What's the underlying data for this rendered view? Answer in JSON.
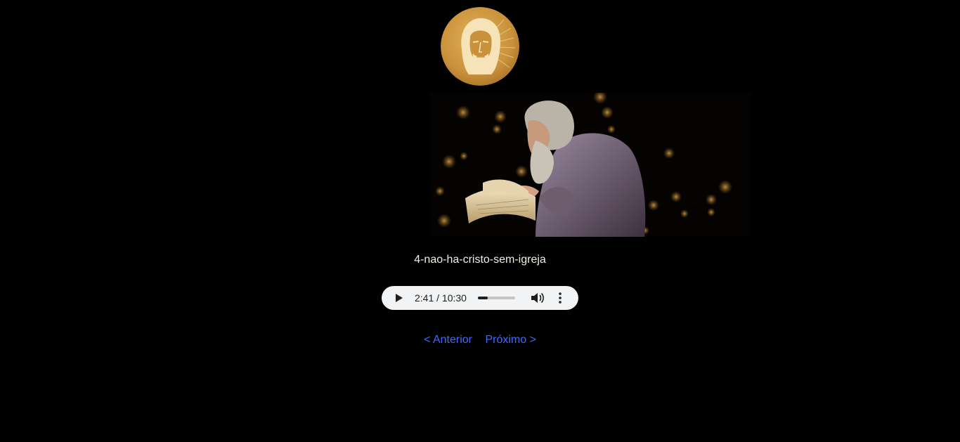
{
  "logo": {
    "icon": "christ-face-medallion-icon",
    "colors": {
      "gold": "#c9913a",
      "light": "#f6e3b8"
    }
  },
  "hero": {
    "icon": "elder-reading-book-image"
  },
  "track": {
    "title": "4-nao-ha-cristo-sem-igreja"
  },
  "player": {
    "play_icon": "play-icon",
    "current_time": "2:41",
    "duration": "10:30",
    "time_display": "2:41 / 10:30",
    "progress": 0.256,
    "volume_icon": "volume-icon",
    "menu_icon": "more-vert-icon"
  },
  "nav": {
    "prev_label": "< Anterior",
    "next_label": "Próximo >",
    "link_color": "#3d6bff"
  }
}
